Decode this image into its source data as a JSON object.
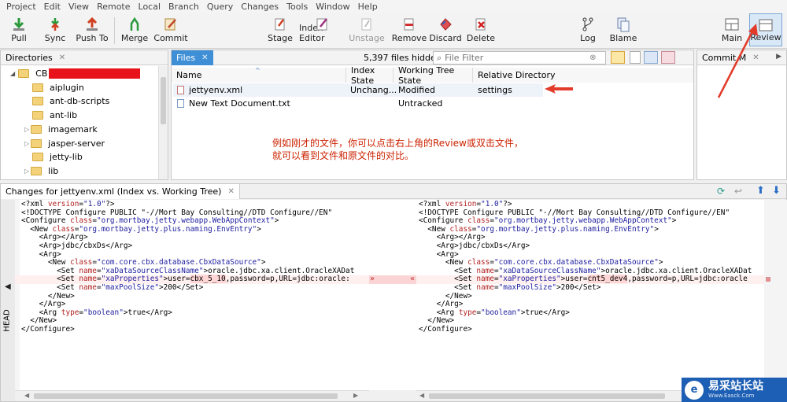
{
  "menu": [
    "Project",
    "Edit",
    "View",
    "Remote",
    "Local",
    "Branch",
    "Query",
    "Changes",
    "Tools",
    "Window",
    "Help"
  ],
  "toolbar": {
    "pull": "Pull",
    "sync": "Sync",
    "push_to": "Push To",
    "merge": "Merge",
    "commit": "Commit",
    "stage": "Stage",
    "index_editor": "Index Editor",
    "unstage": "Unstage",
    "remove": "Remove",
    "discard": "Discard",
    "delete": "Delete",
    "log": "Log",
    "blame": "Blame",
    "main": "Main",
    "review": "Review"
  },
  "directories": {
    "tab": "Directories",
    "root": "CB",
    "items": [
      "aiplugin",
      "ant-db-scripts",
      "ant-lib",
      "imagemark",
      "jasper-server",
      "jetty-lib",
      "lib"
    ]
  },
  "files": {
    "tab": "Files",
    "hidden": "5,397 files hidden",
    "filter_placeholder": "File Filter",
    "columns": [
      "Name",
      "Index State",
      "Working Tree State",
      "Relative Directory"
    ],
    "rows": [
      {
        "name": "jettyenv.xml",
        "index": "Unchang...",
        "wt": "Modified",
        "dir": "settings"
      },
      {
        "name": "New Text Document.txt",
        "index": "",
        "wt": "Untracked",
        "dir": ""
      }
    ],
    "annotation_line1": "例如刚才的文件，你可以点击右上角的Review或双击文件，",
    "annotation_line2": "就可以看到文件和原文件的对比。"
  },
  "commit_tab": "Commit M",
  "changes": {
    "title": "Changes for jettyenv.xml (Index vs. Working Tree)",
    "head_label": "HEAD",
    "left": [
      "<?xml version=\"1.0\"?>",
      "<!DOCTYPE Configure PUBLIC \"-//Mort Bay Consulting//DTD Configure//EN\"",
      "<Configure class=\"org.mortbay.jetty.webapp.WebAppContext\">",
      "  <New class=\"org.mortbay.jetty.plus.naming.EnvEntry\">",
      "    <Arg></Arg>",
      "    <Arg>jdbc/cbxDs</Arg>",
      "    <Arg>",
      "      <New class=\"com.core.cbx.database.CbxDataSource\">",
      "        <Set name=\"xaDataSourceClassName\">oracle.jdbc.xa.client.OracleXADat",
      "        <Set name=\"xaProperties\">user=cbx_5_10,password=p,URL=jdbc:oracle:",
      "        <Set name=\"maxPoolSize\">200</Set>",
      "      </New>",
      "    </Arg>",
      "    <Arg type=\"boolean\">true</Arg>",
      "  </New>",
      "</Configure>"
    ],
    "right": [
      "<?xml version=\"1.0\"?>",
      "<!DOCTYPE Configure PUBLIC \"-//Mort Bay Consulting//DTD Configure//EN\"",
      "<Configure class=\"org.mortbay.jetty.webapp.WebAppContext\">",
      "  <New class=\"org.mortbay.jetty.plus.naming.EnvEntry\">",
      "    <Arg></Arg>",
      "    <Arg>jdbc/cbxDs</Arg>",
      "    <Arg>",
      "      <New class=\"com.core.cbx.database.CbxDataSource\">",
      "        <Set name=\"xaDataSourceClassName\">oracle.jdbc.xa.client.OracleXADat",
      "        <Set name=\"xaProperties\">user=cnt5_dev4,password=p,URL=jdbc:oracle",
      "        <Set name=\"maxPoolSize\">200</Set>",
      "      </New>",
      "    </Arg>",
      "    <Arg type=\"boolean\">true</Arg>",
      "  </New>",
      "</Configure>"
    ],
    "left_hl": "cbx_5_10",
    "right_hl": "cnt5_dev4",
    "merge_right": "»",
    "merge_left": "«"
  },
  "watermark": {
    "title": "易采站长站",
    "sub": "Www.Easck.Com"
  }
}
